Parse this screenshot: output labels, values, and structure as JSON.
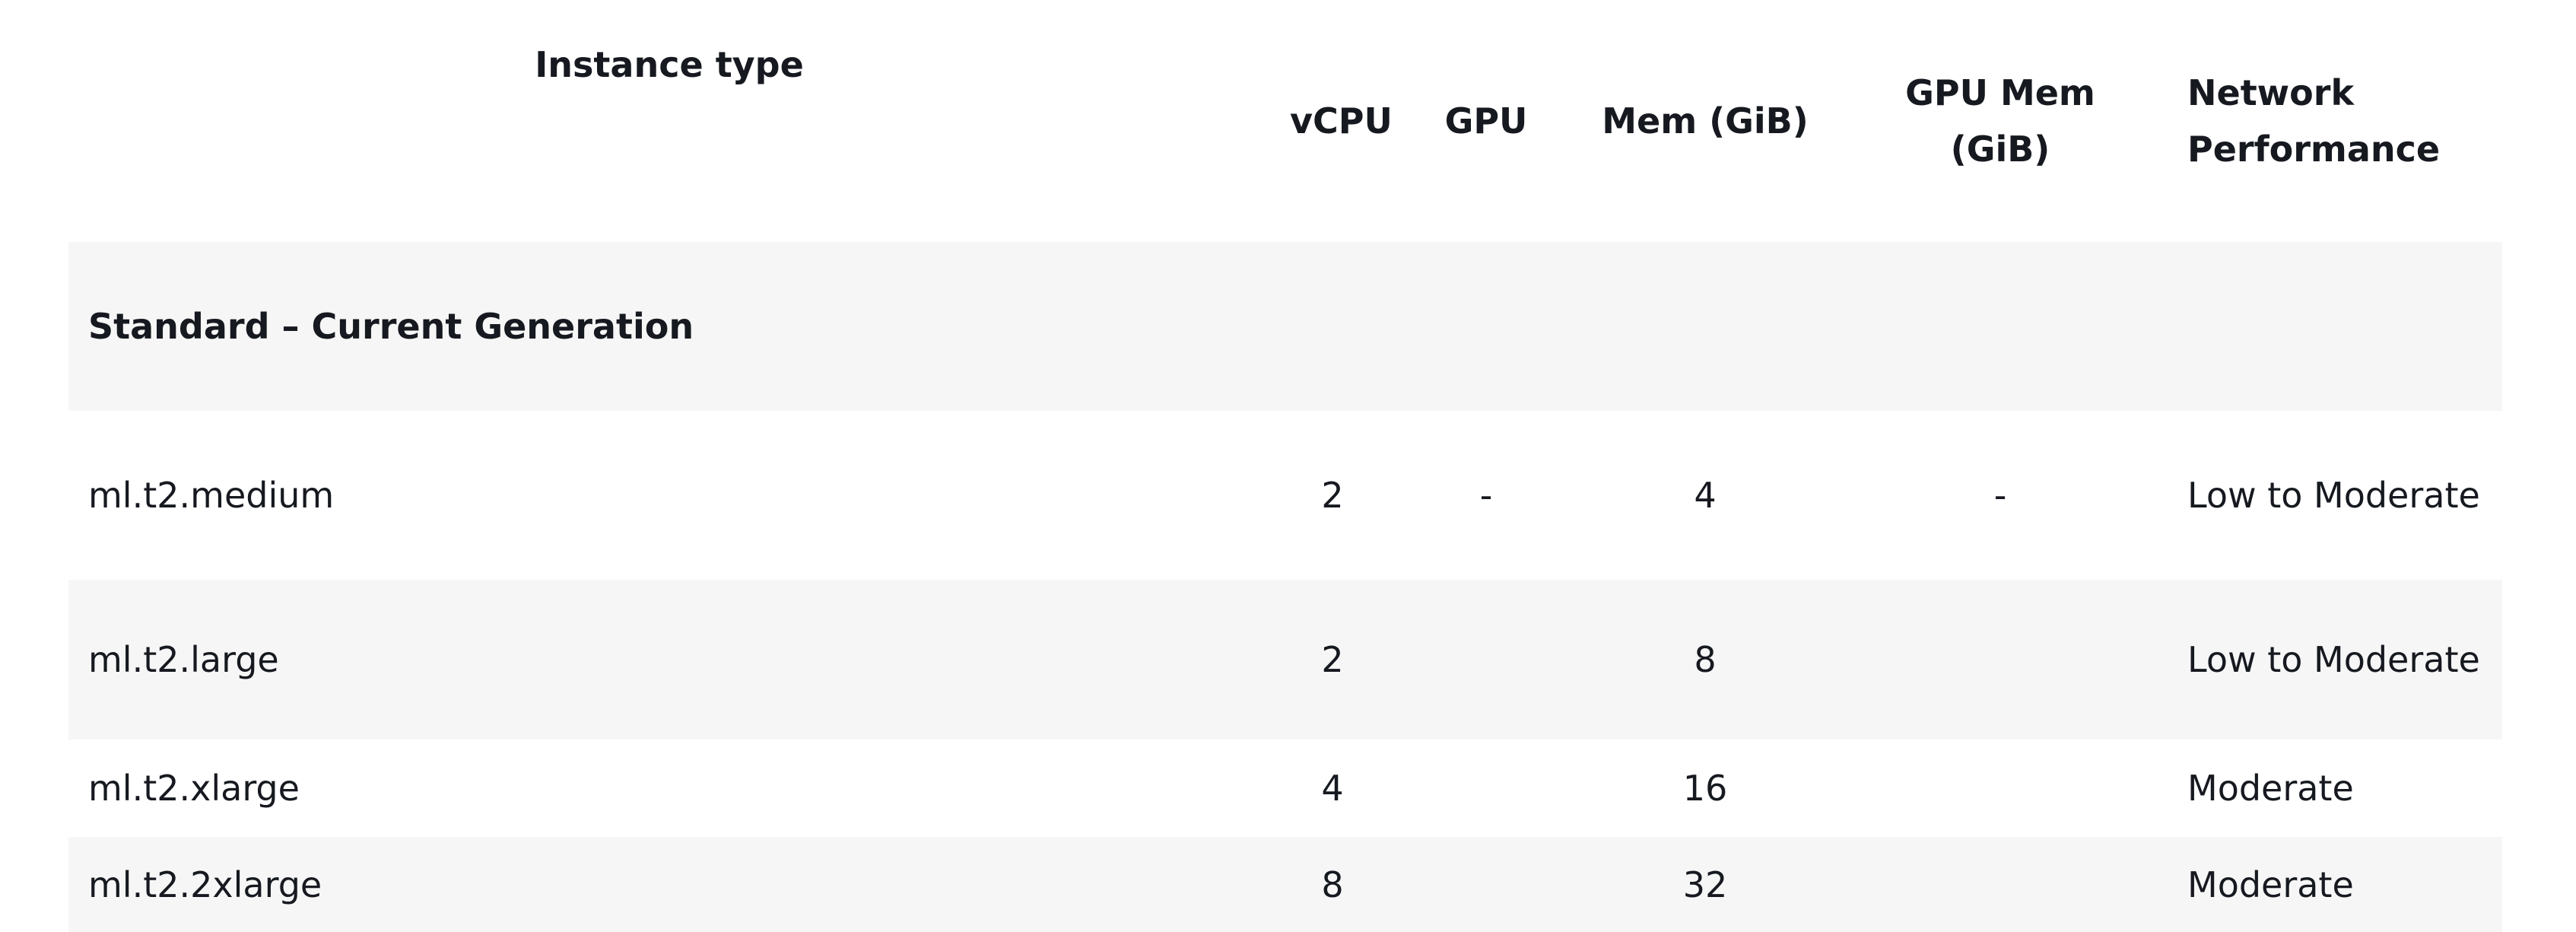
{
  "table": {
    "headers": {
      "instance_type": "Instance type",
      "vcpu": "vCPU",
      "gpu": "GPU",
      "mem": "Mem (GiB)",
      "gpu_mem": "GPU Mem (GiB)",
      "network": "Network Performance"
    },
    "group": "Standard – Current Generation",
    "rows": [
      {
        "instance": "ml.t2.medium",
        "vcpu": "2",
        "gpu": "-",
        "mem": "4",
        "gpu_mem": "-",
        "network": "Low to Moderate"
      },
      {
        "instance": "ml.t2.large",
        "vcpu": "2",
        "gpu": "",
        "mem": "8",
        "gpu_mem": "",
        "network": "Low to Moderate"
      },
      {
        "instance": "ml.t2.xlarge",
        "vcpu": "4",
        "gpu": "",
        "mem": "16",
        "gpu_mem": "",
        "network": "Moderate"
      },
      {
        "instance": "ml.t2.2xlarge",
        "vcpu": "8",
        "gpu": "",
        "mem": "32",
        "gpu_mem": "",
        "network": "Moderate"
      }
    ]
  }
}
